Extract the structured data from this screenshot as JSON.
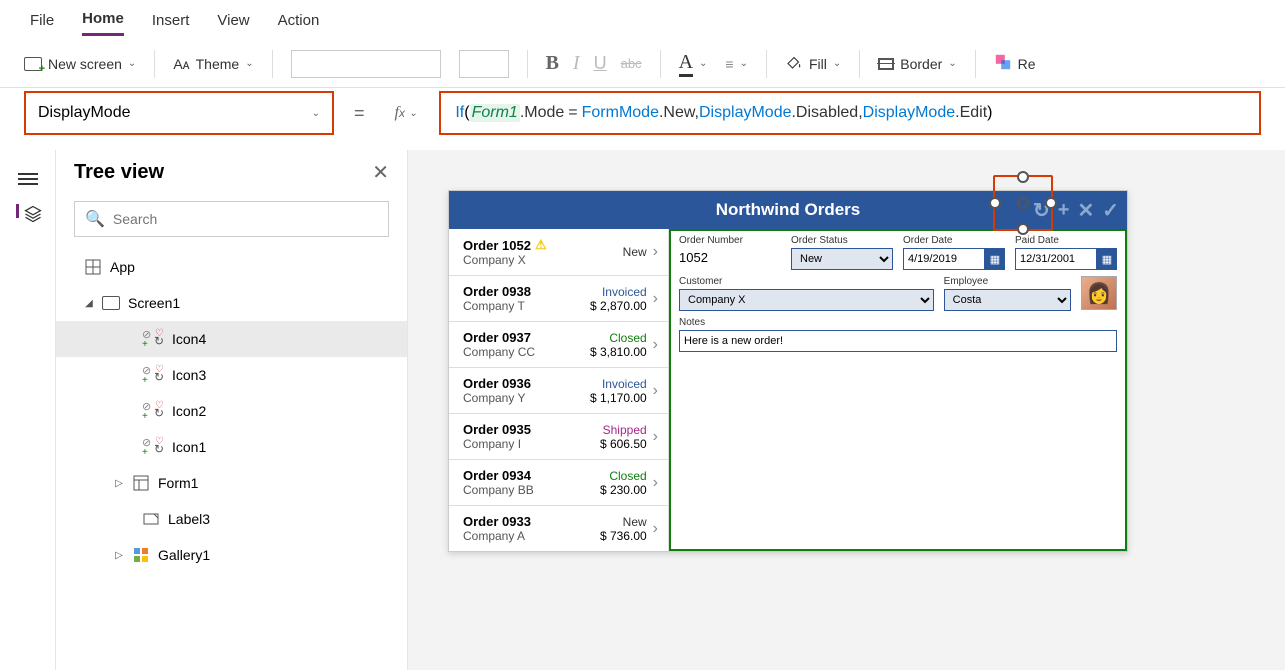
{
  "menu": {
    "file": "File",
    "home": "Home",
    "insert": "Insert",
    "view": "View",
    "action": "Action"
  },
  "ribbon": {
    "newScreen": "New screen",
    "theme": "Theme",
    "fill": "Fill",
    "border": "Border",
    "reorder": "Re"
  },
  "property": {
    "name": "DisplayMode"
  },
  "formula": {
    "fn": "If",
    "id": "Form1",
    "prop": ".Mode",
    "eq": " = ",
    "type1": "FormMode",
    "mem1": ".New, ",
    "type2": "DisplayMode",
    "mem2": ".Disabled, ",
    "type3": "DisplayMode",
    "mem3": ".Edit "
  },
  "tree": {
    "title": "Tree view",
    "searchPlaceholder": "Search",
    "app": "App",
    "screen1": "Screen1",
    "icon4": "Icon4",
    "icon3": "Icon3",
    "icon2": "Icon2",
    "icon1": "Icon1",
    "form1": "Form1",
    "label3": "Label3",
    "gallery1": "Gallery1"
  },
  "app": {
    "title": "Northwind Orders",
    "orders": [
      {
        "title": "Order 1052",
        "warn": true,
        "company": "Company X",
        "status": "New",
        "amount": ""
      },
      {
        "title": "Order 0938",
        "company": "Company T",
        "status": "Invoiced",
        "amount": "$ 2,870.00"
      },
      {
        "title": "Order 0937",
        "company": "Company CC",
        "status": "Closed",
        "amount": "$ 3,810.00"
      },
      {
        "title": "Order 0936",
        "company": "Company Y",
        "status": "Invoiced",
        "amount": "$ 1,170.00"
      },
      {
        "title": "Order 0935",
        "company": "Company I",
        "status": "Shipped",
        "amount": "$ 606.50"
      },
      {
        "title": "Order 0934",
        "company": "Company BB",
        "status": "Closed",
        "amount": "$ 230.00"
      },
      {
        "title": "Order 0933",
        "company": "Company A",
        "status": "New",
        "amount": "$ 736.00"
      }
    ],
    "form": {
      "orderNumLabel": "Order Number",
      "orderNum": "1052",
      "orderStatusLabel": "Order Status",
      "orderStatus": "New",
      "orderDateLabel": "Order Date",
      "orderDate": "4/19/2019",
      "paidDateLabel": "Paid Date",
      "paidDate": "12/31/2001",
      "customerLabel": "Customer",
      "customer": "Company X",
      "employeeLabel": "Employee",
      "employee": "Costa",
      "notesLabel": "Notes",
      "notes": "Here is a new order!"
    }
  }
}
